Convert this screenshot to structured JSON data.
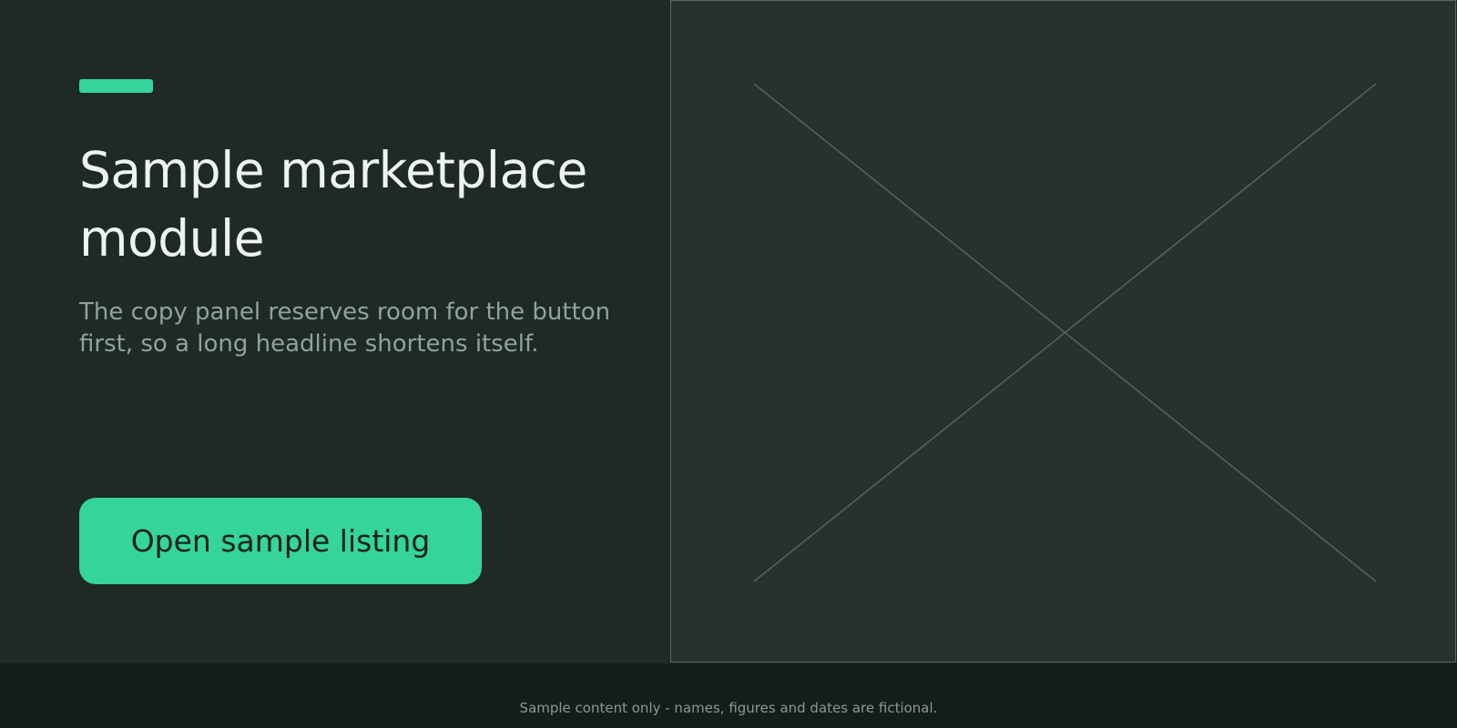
{
  "hero": {
    "headline": "Sample marketplace module",
    "description": "The copy panel reserves room for the button first, so a long headline shortens itself.",
    "cta_label": "Open sample listing",
    "accent_color": "#35d49a"
  },
  "media": {
    "placeholder_icon": "image-placeholder-icon"
  },
  "footer": {
    "note": "Sample content only - names, figures and dates are fictional."
  }
}
